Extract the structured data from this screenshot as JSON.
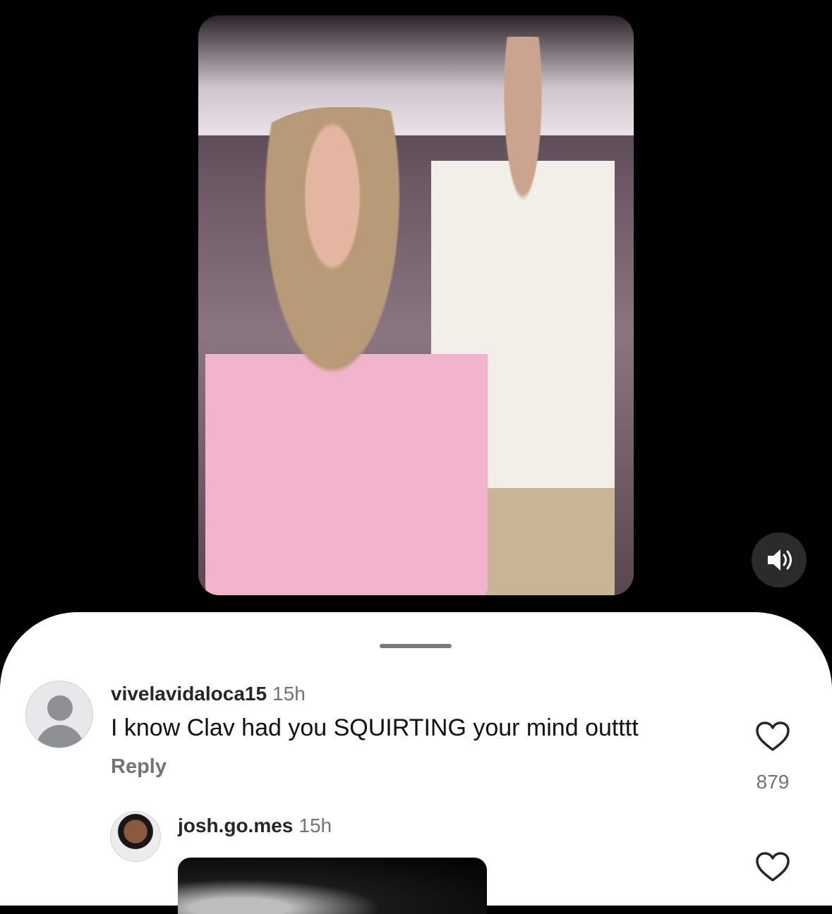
{
  "video": {
    "mute_icon": "speaker-sound-icon"
  },
  "comments": [
    {
      "username": "vivelavidaloca15",
      "time": "15h",
      "text": "I know Clav had you SQUIRTING your mind outttt",
      "reply_label": "Reply",
      "like_icon": "heart-outline-icon",
      "likes": "879"
    },
    {
      "username": "josh.go.mes",
      "time": "15h",
      "like_icon": "heart-outline-icon"
    }
  ],
  "colors": {
    "background": "#000000",
    "sheet": "#ffffff",
    "secondary_text": "#737373",
    "primary_text": "#262626"
  }
}
